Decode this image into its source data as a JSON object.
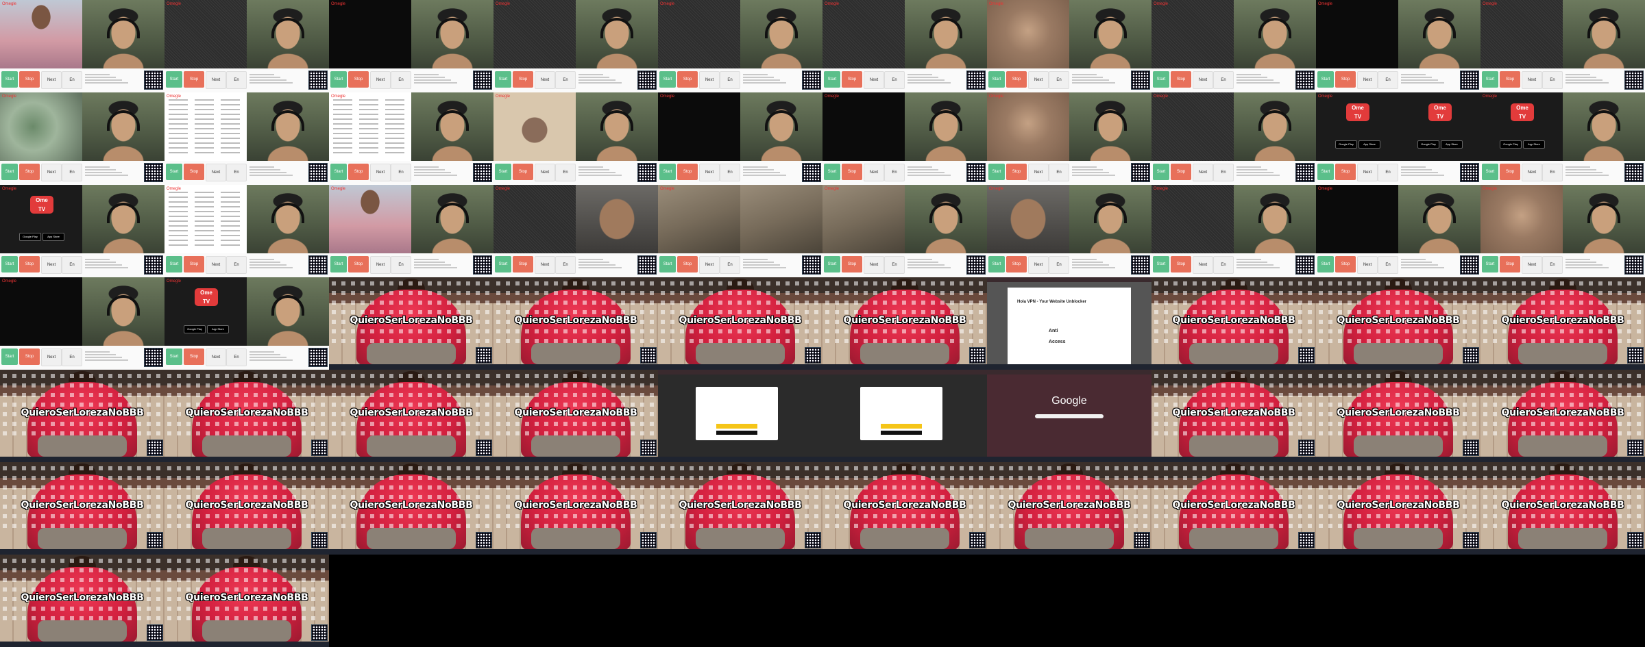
{
  "omegle": {
    "brand": "Omegle",
    "start": "Start",
    "stop": "Stop",
    "next": "Next",
    "lang": "En"
  },
  "ome_tv": {
    "logo_line1": "Ome",
    "logo_line2": "TV",
    "google_play": "Google Play",
    "app_store": "App Store"
  },
  "desktop": {
    "caption": "QuieroSerLorezaNoBBB"
  },
  "browser": {
    "google_logo": "Google"
  },
  "hola": {
    "title": "Hola VPN - Your Website Unblocker",
    "line1": "Anti",
    "line2": "Access"
  },
  "tiles": [
    "chat-woman",
    "chat-guy",
    "chat-noise",
    "chat-guy",
    "chat-dark",
    "chat-guy",
    "chat-noise",
    "chat-guy",
    "chat-noise",
    "chat-guy",
    "chat-noise",
    "chat-guy",
    "chat-skin",
    "chat-guy",
    "chat-noise",
    "chat-guy",
    "chat-dark",
    "chat-guy",
    "chat-noise",
    "chat-guy",
    "chat-green",
    "chat-guy",
    "menu",
    "chat-guy",
    "menu",
    "chat-guy",
    "chat-beige",
    "chat-guy",
    "chat-dark",
    "chat-guy",
    "chat-dark",
    "chat-guy",
    "chat-skin",
    "chat-guy",
    "chat-noise",
    "chat-guy",
    "ome",
    "ome",
    "ome",
    "chat-guy",
    "ome",
    "chat-guy",
    "menu",
    "chat-guy",
    "chat-woman",
    "chat-guy",
    "chat-noise",
    "chat-selfie",
    "chat-room",
    "chat-room",
    "chat-room",
    "chat-guy",
    "chat-selfie",
    "chat-guy",
    "chat-noise",
    "chat-guy",
    "chat-dark",
    "chat-guy",
    "chat-skin",
    "chat-guy",
    "chat-dark",
    "chat-guy",
    "ome",
    "chat-guy",
    "desk",
    "desk",
    "desk",
    "desk",
    "desk",
    "desk",
    "desk",
    "desk",
    "hola",
    "hola",
    "desk",
    "desk",
    "desk",
    "desk",
    "desk",
    "desk",
    "desk",
    "desk",
    "desk",
    "desk",
    "desk",
    "desk",
    "desk",
    "desk",
    "popup",
    "popup",
    "popup",
    "popup",
    "google",
    "google",
    "desk",
    "desk",
    "desk",
    "desk",
    "desk",
    "desk",
    "desk",
    "desk",
    "desk",
    "desk",
    "desk",
    "desk",
    "desk",
    "desk",
    "desk",
    "desk",
    "desk",
    "desk",
    "desk",
    "desk",
    "desk",
    "desk",
    "desk",
    "desk",
    "desk",
    "desk",
    "desk",
    "desk",
    "desk",
    "desk"
  ]
}
